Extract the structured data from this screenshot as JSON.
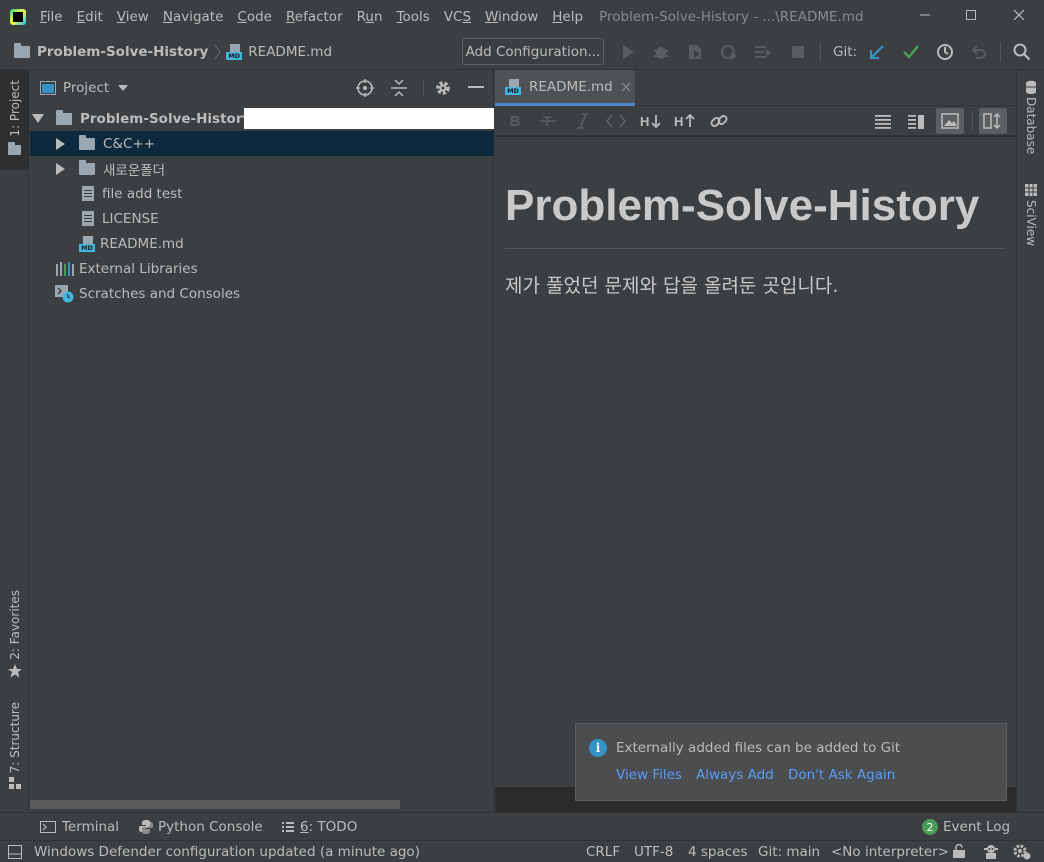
{
  "menubar": {
    "items": [
      {
        "pre": "",
        "u": "F",
        "post": "ile"
      },
      {
        "pre": "",
        "u": "E",
        "post": "dit"
      },
      {
        "pre": "",
        "u": "V",
        "post": "iew"
      },
      {
        "pre": "",
        "u": "N",
        "post": "avigate"
      },
      {
        "pre": "",
        "u": "C",
        "post": "ode"
      },
      {
        "pre": "",
        "u": "R",
        "post": "efactor"
      },
      {
        "pre": "R",
        "u": "u",
        "post": "n"
      },
      {
        "pre": "",
        "u": "T",
        "post": "ools"
      },
      {
        "pre": "VC",
        "u": "S",
        "post": ""
      },
      {
        "pre": "",
        "u": "W",
        "post": "indow"
      },
      {
        "pre": "",
        "u": "H",
        "post": "elp"
      }
    ],
    "window_title": "Problem-Solve-History - ...\\README.md"
  },
  "navbar": {
    "project": "Problem-Solve-History",
    "file": "README.md",
    "add_config": "Add Configuration...",
    "git_label": "Git:"
  },
  "left_stripe": {
    "project": "1: Project",
    "favorites": "2: Favorites",
    "structure": "7: Structure"
  },
  "right_stripe": {
    "database": "Database",
    "sciview": "SciView"
  },
  "project_panel": {
    "title": "Project",
    "tree": {
      "root": "Problem-Solve-History",
      "items": [
        "C&C++",
        "새로운폴더",
        "file add test",
        "LICENSE",
        "README.md"
      ],
      "external": "External Libraries",
      "scratches": "Scratches and Consoles"
    }
  },
  "editor": {
    "tab": "README.md",
    "heading": "Problem-Solve-History",
    "paragraph": "제가 풀었던 문제와 답을 올려둔 곳입니다."
  },
  "notification": {
    "message": "Externally added files can be added to Git",
    "links": [
      "View Files",
      "Always Add",
      "Don't Ask Again"
    ]
  },
  "bottom_tools": {
    "terminal": "Terminal",
    "python_console": "Python Console",
    "todo_num": "6",
    "todo_label": ": TODO",
    "event_log_count": "2",
    "event_log": "Event Log"
  },
  "statusbar": {
    "message": "Windows Defender configuration updated (a minute ago)",
    "line_sep": "CRLF",
    "encoding": "UTF-8",
    "indent": "4 spaces",
    "git_branch": "Git: main",
    "interpreter": "<No interpreter>"
  },
  "colors": {
    "background": "#3c3f41",
    "editor_bg": "#2b2b2b",
    "selection": "#0d293e",
    "link": "#589df6",
    "git_update": "#3592c4",
    "git_commit": "#499c54",
    "tab_underline": "#4a88c7"
  }
}
